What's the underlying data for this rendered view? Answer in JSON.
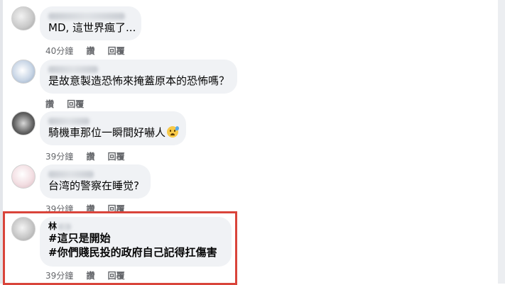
{
  "comments": [
    {
      "author": "",
      "text": "MD, 這世界瘋了...",
      "time": "40分鐘",
      "like": "讚",
      "reply": "回覆"
    },
    {
      "author": "",
      "text": "是故意製造恐怖來掩蓋原本的恐怖嗎？",
      "time": "",
      "like": "讚",
      "reply": "回覆"
    },
    {
      "author": "",
      "text": "騎機車那位一瞬間好嚇人",
      "emoji": "anxious-face-with-sweat-icon",
      "time": "39分鐘",
      "like": "讚",
      "reply": "回覆"
    },
    {
      "author": "",
      "text": "台湾的警察在睡觉?",
      "time": "39分鐘",
      "like": "讚",
      "reply": "回覆"
    },
    {
      "author": "林",
      "line1": "#這只是開始",
      "line2": "#你們賤民投的政府自己記得扛傷害",
      "time": "39分鐘",
      "like": "讚",
      "reply": "回覆"
    }
  ],
  "highlight_color": "#d9443a"
}
